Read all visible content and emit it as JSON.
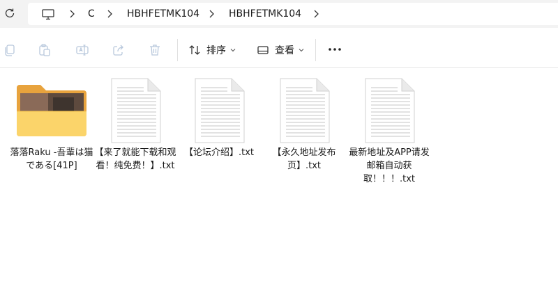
{
  "breadcrumb": {
    "items": [
      "C",
      "HBHFETMK104",
      "HBHFETMK104"
    ]
  },
  "toolbar": {
    "sort_label": "排序",
    "view_label": "查看"
  },
  "files": [
    {
      "name": "落落Raku -吾輩は猫である[41P]",
      "type": "folder"
    },
    {
      "name": "【来了就能下载和观看！纯免费！】.txt",
      "type": "txt"
    },
    {
      "name": "【论坛介绍】.txt",
      "type": "txt"
    },
    {
      "name": "【永久地址发布页】.txt",
      "type": "txt"
    },
    {
      "name": "最新地址及APP请发邮箱自动获取！！！.txt",
      "type": "txt"
    }
  ],
  "icons": {
    "refresh": "refresh-icon",
    "computer": "computer-icon",
    "copy": "copy-icon",
    "paste": "paste-icon",
    "rename": "rename-icon",
    "share": "share-icon",
    "delete": "delete-icon",
    "sort": "sort-icon",
    "view": "view-icon",
    "more": "more-icon"
  }
}
